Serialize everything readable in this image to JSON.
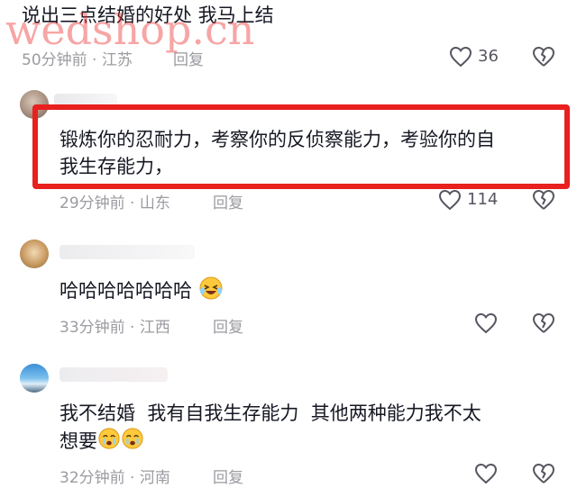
{
  "watermark": "wedshop.cn",
  "comments": [
    {
      "text": "说出三点结婚的好处 我马上结",
      "time": "50分钟前",
      "location": "江苏",
      "reply": "回复",
      "likes": "36"
    },
    {
      "text_line1": "锻炼你的忍耐力，考察你的反侦察能力，考验你的自",
      "text_line2": "我生存能力，",
      "time": "29分钟前",
      "location": "山东",
      "reply": "回复",
      "likes": "114"
    },
    {
      "text": "哈哈哈哈哈哈哈",
      "time": "33分钟前",
      "location": "江西",
      "reply": "回复"
    },
    {
      "text_line1": "我不结婚  我有自我生存能力  其他两种能力我不太",
      "text_line2": "想要",
      "time": "32分钟前",
      "location": "河南",
      "reply": "回复"
    }
  ],
  "meta_separator": " · ",
  "icons": {
    "like": "heart-outline-icon",
    "dislike": "broken-heart-icon",
    "emoji_laugh": "laughing-emoji-icon",
    "emoji_cry": "crying-emoji-icon"
  },
  "colors": {
    "highlight": "#e8201e",
    "meta_text": "#9b9ba1",
    "watermark": "#eb2828"
  }
}
